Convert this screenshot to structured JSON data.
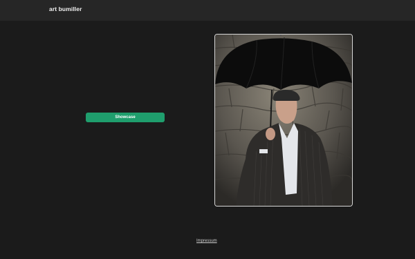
{
  "header": {
    "brand": "art bumiller"
  },
  "main": {
    "showcase_label": "Showcase"
  },
  "photo": {
    "subject": "man holding a black umbrella in front of a stone wall"
  },
  "footer": {
    "impressum_label": "Impressum"
  },
  "colors": {
    "background": "#1b1b1b",
    "topbar": "#262626",
    "accent": "#1f9e6d"
  }
}
